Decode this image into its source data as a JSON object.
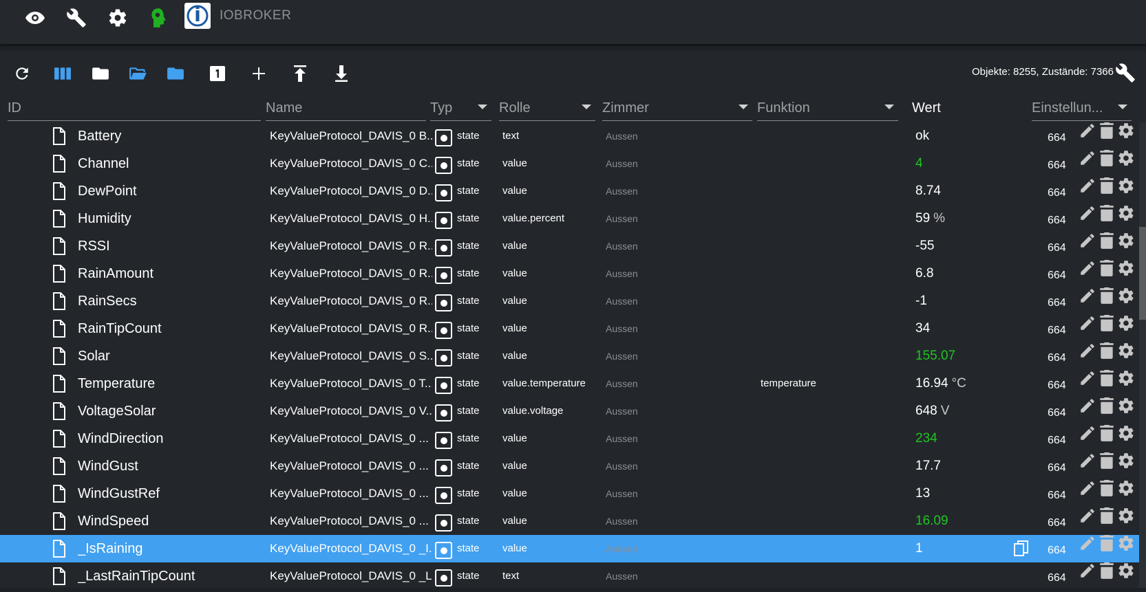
{
  "app": {
    "brand": "IOBROKER"
  },
  "header": {
    "stats": "Objekte: 8255, Zustände: 7366"
  },
  "columns": {
    "id": "ID",
    "name": "Name",
    "type": "Typ",
    "role": "Rolle",
    "room": "Zimmer",
    "function": "Funktion",
    "value": "Wert",
    "settings": "Einstellun..."
  },
  "toolbar_icons": [
    "refresh-icon",
    "columns-icon",
    "folder-icon",
    "folder-open-icon",
    "folder-icon",
    "one-icon",
    "add-icon",
    "upload-icon",
    "download-icon"
  ],
  "colors": {
    "selected_row": "#42a0f0",
    "value_green": "#21c421",
    "accent_blue": "#42a0f0"
  },
  "rows": [
    {
      "id": "Battery",
      "name": "KeyValueProtocol_DAVIS_0 B...",
      "type": "state",
      "role": "text",
      "room": "Aussen",
      "function": "",
      "value": "ok",
      "unit": "",
      "green": false,
      "acl": "664"
    },
    {
      "id": "Channel",
      "name": "KeyValueProtocol_DAVIS_0 C...",
      "type": "state",
      "role": "value",
      "room": "Aussen",
      "function": "",
      "value": "4",
      "unit": "",
      "green": true,
      "acl": "664"
    },
    {
      "id": "DewPoint",
      "name": "KeyValueProtocol_DAVIS_0 D...",
      "type": "state",
      "role": "value",
      "room": "Aussen",
      "function": "",
      "value": "8.74",
      "unit": "",
      "green": false,
      "acl": "664"
    },
    {
      "id": "Humidity",
      "name": "KeyValueProtocol_DAVIS_0 H...",
      "type": "state",
      "role": "value.percent",
      "room": "Aussen",
      "function": "",
      "value": "59",
      "unit": "%",
      "green": false,
      "acl": "664"
    },
    {
      "id": "RSSI",
      "name": "KeyValueProtocol_DAVIS_0 R...",
      "type": "state",
      "role": "value",
      "room": "Aussen",
      "function": "",
      "value": "-55",
      "unit": "",
      "green": false,
      "acl": "664"
    },
    {
      "id": "RainAmount",
      "name": "KeyValueProtocol_DAVIS_0 R...",
      "type": "state",
      "role": "value",
      "room": "Aussen",
      "function": "",
      "value": "6.8",
      "unit": "",
      "green": false,
      "acl": "664"
    },
    {
      "id": "RainSecs",
      "name": "KeyValueProtocol_DAVIS_0 R...",
      "type": "state",
      "role": "value",
      "room": "Aussen",
      "function": "",
      "value": "-1",
      "unit": "",
      "green": false,
      "acl": "664"
    },
    {
      "id": "RainTipCount",
      "name": "KeyValueProtocol_DAVIS_0 R...",
      "type": "state",
      "role": "value",
      "room": "Aussen",
      "function": "",
      "value": "34",
      "unit": "",
      "green": false,
      "acl": "664"
    },
    {
      "id": "Solar",
      "name": "KeyValueProtocol_DAVIS_0 S...",
      "type": "state",
      "role": "value",
      "room": "Aussen",
      "function": "",
      "value": "155.07",
      "unit": "",
      "green": true,
      "acl": "664"
    },
    {
      "id": "Temperature",
      "name": "KeyValueProtocol_DAVIS_0 T...",
      "type": "state",
      "role": "value.temperature",
      "room": "Aussen",
      "function": "temperature",
      "value": "16.94",
      "unit": "°C",
      "green": false,
      "acl": "664"
    },
    {
      "id": "VoltageSolar",
      "name": "KeyValueProtocol_DAVIS_0 V...",
      "type": "state",
      "role": "value.voltage",
      "room": "Aussen",
      "function": "",
      "value": "648",
      "unit": "V",
      "green": false,
      "acl": "664"
    },
    {
      "id": "WindDirection",
      "name": "KeyValueProtocol_DAVIS_0 ...",
      "type": "state",
      "role": "value",
      "room": "Aussen",
      "function": "",
      "value": "234",
      "unit": "",
      "green": true,
      "acl": "664"
    },
    {
      "id": "WindGust",
      "name": "KeyValueProtocol_DAVIS_0 ...",
      "type": "state",
      "role": "value",
      "room": "Aussen",
      "function": "",
      "value": "17.7",
      "unit": "",
      "green": false,
      "acl": "664"
    },
    {
      "id": "WindGustRef",
      "name": "KeyValueProtocol_DAVIS_0 ...",
      "type": "state",
      "role": "value",
      "room": "Aussen",
      "function": "",
      "value": "13",
      "unit": "",
      "green": false,
      "acl": "664"
    },
    {
      "id": "WindSpeed",
      "name": "KeyValueProtocol_DAVIS_0 ...",
      "type": "state",
      "role": "value",
      "room": "Aussen",
      "function": "",
      "value": "16.09",
      "unit": "",
      "green": true,
      "acl": "664"
    },
    {
      "id": "_IsRaining",
      "name": "KeyValueProtocol_DAVIS_0 _I...",
      "type": "state",
      "role": "value",
      "room": "Aussen",
      "function": "",
      "value": "1",
      "unit": "",
      "green": false,
      "acl": "664",
      "selected": true
    },
    {
      "id": "_LastRainTipCount",
      "name": "KeyValueProtocol_DAVIS_0 _L...",
      "type": "state",
      "role": "text",
      "room": "Aussen",
      "function": "",
      "value": "",
      "unit": "",
      "green": false,
      "acl": "664"
    }
  ]
}
